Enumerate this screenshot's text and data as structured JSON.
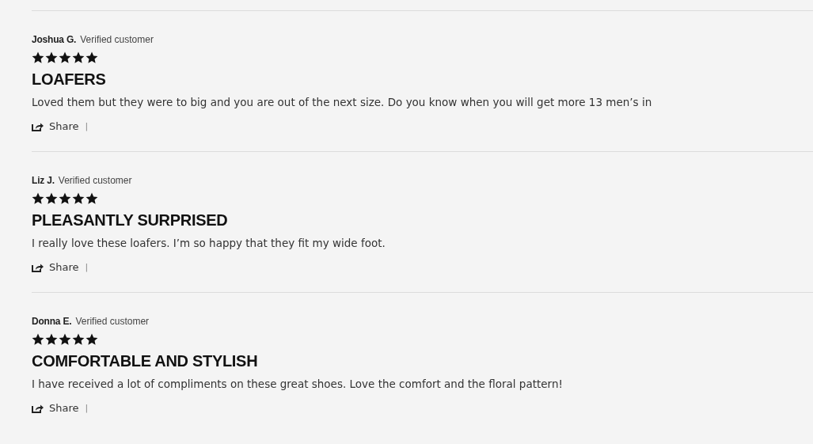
{
  "reviews": [
    {
      "author": "Joshua G.",
      "badge": "Verified customer",
      "stars": 5,
      "title": "LOAFERS",
      "body": "Loved them but they were to big and you are out of the next size. Do you know when you will get more 13 men’s in",
      "share": "Share",
      "separator": "|"
    },
    {
      "author": "Liz J.",
      "badge": "Verified customer",
      "stars": 5,
      "title": "PLEASANTLY SURPRISED",
      "body": "I really love these loafers. I’m so happy that they fit my wide foot.",
      "share": "Share",
      "separator": "|"
    },
    {
      "author": "Donna E.",
      "badge": "Verified customer",
      "stars": 5,
      "title": "COMFORTABLE AND STYLISH",
      "body": "I have received a lot of compliments on these great shoes. Love the comfort and the floral pattern!",
      "share": "Share",
      "separator": "|"
    }
  ]
}
